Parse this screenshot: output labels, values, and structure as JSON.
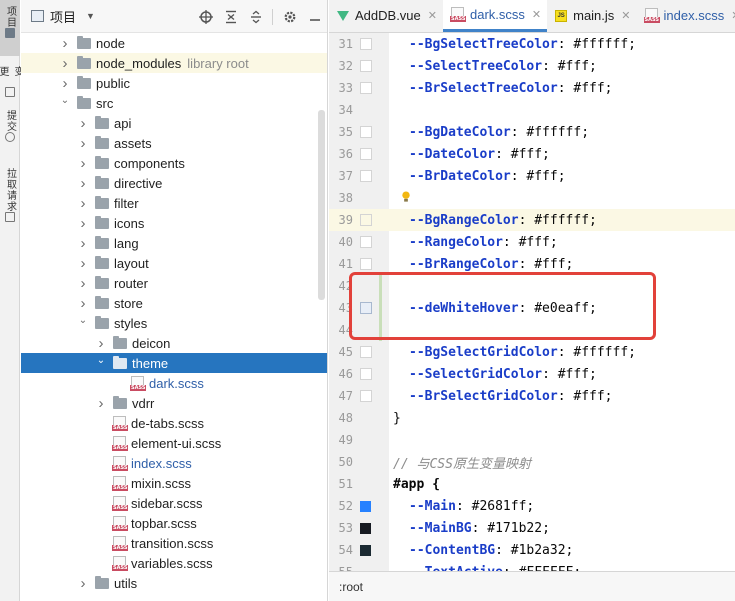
{
  "sidestrip": {
    "tabs": [
      {
        "label": "项目",
        "icon": "folder-icon"
      },
      {
        "label": "变更",
        "icon": "git-changes-icon"
      },
      {
        "label": "提交",
        "icon": "commit-icon"
      },
      {
        "label": "拉取请求",
        "icon": "pull-request-icon"
      }
    ]
  },
  "project": {
    "title": "项目",
    "tools": [
      "add-target-icon",
      "collapse-all-icon",
      "expand-all-icon",
      "settings-gear-icon",
      "hide-panel-icon"
    ],
    "tree": [
      {
        "name": "node",
        "type": "folder",
        "depth": 1,
        "arrow": "›"
      },
      {
        "name": "node_modules",
        "type": "folder",
        "depth": 1,
        "arrow": "›",
        "extra": "library root",
        "highlight": true
      },
      {
        "name": "public",
        "type": "folder",
        "depth": 1,
        "arrow": "›"
      },
      {
        "name": "src",
        "type": "folder",
        "depth": 1,
        "arrow": "⌄"
      },
      {
        "name": "api",
        "type": "folder",
        "depth": 2,
        "arrow": "›"
      },
      {
        "name": "assets",
        "type": "folder",
        "depth": 2,
        "arrow": "›"
      },
      {
        "name": "components",
        "type": "folder",
        "depth": 2,
        "arrow": "›"
      },
      {
        "name": "directive",
        "type": "folder",
        "depth": 2,
        "arrow": "›"
      },
      {
        "name": "filter",
        "type": "folder",
        "depth": 2,
        "arrow": "›"
      },
      {
        "name": "icons",
        "type": "folder",
        "depth": 2,
        "arrow": "›"
      },
      {
        "name": "lang",
        "type": "folder",
        "depth": 2,
        "arrow": "›"
      },
      {
        "name": "layout",
        "type": "folder",
        "depth": 2,
        "arrow": "›"
      },
      {
        "name": "router",
        "type": "folder",
        "depth": 2,
        "arrow": "›"
      },
      {
        "name": "store",
        "type": "folder",
        "depth": 2,
        "arrow": "›"
      },
      {
        "name": "styles",
        "type": "folder",
        "depth": 2,
        "arrow": "⌄"
      },
      {
        "name": "deicon",
        "type": "folder",
        "depth": 3,
        "arrow": "›"
      },
      {
        "name": "theme",
        "type": "folder",
        "depth": 3,
        "arrow": "⌄",
        "selected": true
      },
      {
        "name": "dark.scss",
        "type": "sass",
        "depth": 4,
        "arrow": "",
        "blue": true
      },
      {
        "name": "vdrr",
        "type": "folder",
        "depth": 3,
        "arrow": "›"
      },
      {
        "name": "de-tabs.scss",
        "type": "sass",
        "depth": 3,
        "arrow": ""
      },
      {
        "name": "element-ui.scss",
        "type": "sass",
        "depth": 3,
        "arrow": ""
      },
      {
        "name": "index.scss",
        "type": "sass",
        "depth": 3,
        "arrow": "",
        "blue": true
      },
      {
        "name": "mixin.scss",
        "type": "sass",
        "depth": 3,
        "arrow": ""
      },
      {
        "name": "sidebar.scss",
        "type": "sass",
        "depth": 3,
        "arrow": ""
      },
      {
        "name": "topbar.scss",
        "type": "sass",
        "depth": 3,
        "arrow": ""
      },
      {
        "name": "transition.scss",
        "type": "sass",
        "depth": 3,
        "arrow": ""
      },
      {
        "name": "variables.scss",
        "type": "sass",
        "depth": 3,
        "arrow": ""
      },
      {
        "name": "utils",
        "type": "folder",
        "depth": 2,
        "arrow": "›"
      }
    ]
  },
  "editor": {
    "tabs": [
      {
        "label": "AddDB.vue",
        "icon": "vue-icon",
        "active": false
      },
      {
        "label": "dark.scss",
        "icon": "sass-icon",
        "active": true
      },
      {
        "label": "main.js",
        "icon": "js-icon",
        "active": false
      },
      {
        "label": "index.scss",
        "icon": "sass-icon",
        "active": false
      }
    ],
    "lines": [
      {
        "n": "31",
        "prop": "--BgSelectTreeColor",
        "val": ": #ffffff;",
        "mk": "box"
      },
      {
        "n": "32",
        "prop": "--SelectTreeColor",
        "val": ": #fff;",
        "mk": "box"
      },
      {
        "n": "33",
        "prop": "--BrSelectTreeColor",
        "val": ": #fff;",
        "mk": "box"
      },
      {
        "n": "34",
        "mk": "none"
      },
      {
        "n": "35",
        "prop": "--BgDateColor",
        "val": ": #ffffff;",
        "mk": "box"
      },
      {
        "n": "36",
        "prop": "--DateColor",
        "val": ": #fff;",
        "mk": "box"
      },
      {
        "n": "37",
        "prop": "--BrDateColor",
        "val": ": #fff;",
        "mk": "box"
      },
      {
        "n": "38",
        "mk": "none"
      },
      {
        "n": "39",
        "prop": "--BgRangeColor",
        "val": ": #ffffff;",
        "mk": "box",
        "hl": true
      },
      {
        "n": "40",
        "prop": "--RangeColor",
        "val": ": #fff;",
        "mk": "box"
      },
      {
        "n": "41",
        "prop": "--BrRangeColor",
        "val": ": #fff;",
        "mk": "box"
      },
      {
        "n": "42",
        "mk": "none"
      },
      {
        "n": "43",
        "prop": "--deWhiteHover",
        "val": ": #e0eaff;",
        "mk": "hlbox"
      },
      {
        "n": "44",
        "mk": "none"
      },
      {
        "n": "45",
        "prop": "--BgSelectGridColor",
        "val": ": #ffffff;",
        "mk": "box"
      },
      {
        "n": "46",
        "prop": "--SelectGridColor",
        "val": ": #fff;",
        "mk": "box"
      },
      {
        "n": "47",
        "prop": "--BrSelectGridColor",
        "val": ": #fff;",
        "mk": "box"
      },
      {
        "n": "48",
        "plain": "}",
        "mk": "none",
        "indent": 0
      },
      {
        "n": "49",
        "mk": "none"
      },
      {
        "n": "50",
        "comment": "// 与CSS原生变量映射",
        "mk": "none",
        "indent": 0
      },
      {
        "n": "51",
        "selector": "#app {",
        "mk": "none",
        "indent": 0
      },
      {
        "n": "52",
        "prop": "--Main",
        "val": ": #2681ff;",
        "mk": "swatch",
        "swatch": "#2681ff"
      },
      {
        "n": "53",
        "prop": "--MainBG",
        "val": ": #171b22;",
        "mk": "swatch",
        "swatch": "#171b22"
      },
      {
        "n": "54",
        "prop": "--ContentBG",
        "val": ": #1b2a32;",
        "mk": "swatch",
        "swatch": "#1b2a32"
      },
      {
        "n": "55",
        "prop": "--TextActive",
        "val": ": #FFFFFF;",
        "mk": "none"
      }
    ]
  },
  "status": {
    "path": ":root"
  }
}
